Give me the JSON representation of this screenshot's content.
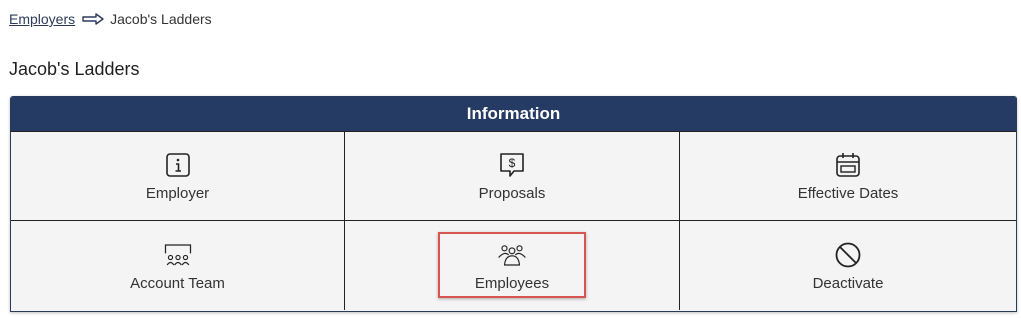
{
  "breadcrumb": {
    "parent": "Employers",
    "current": "Jacob's Ladders"
  },
  "page": {
    "title": "Jacob's Ladders"
  },
  "panel": {
    "title": "Information",
    "header_color": "#253b63",
    "tiles": [
      {
        "label": "Employer",
        "icon": "info-icon"
      },
      {
        "label": "Proposals",
        "icon": "dollar-speech-icon"
      },
      {
        "label": "Effective Dates",
        "icon": "calendar-icon"
      },
      {
        "label": "Account Team",
        "icon": "presentation-team-icon"
      },
      {
        "label": "Employees",
        "icon": "people-group-icon",
        "highlighted": true
      },
      {
        "label": "Deactivate",
        "icon": "ban-icon"
      }
    ]
  },
  "highlight_color": "#d9534f"
}
